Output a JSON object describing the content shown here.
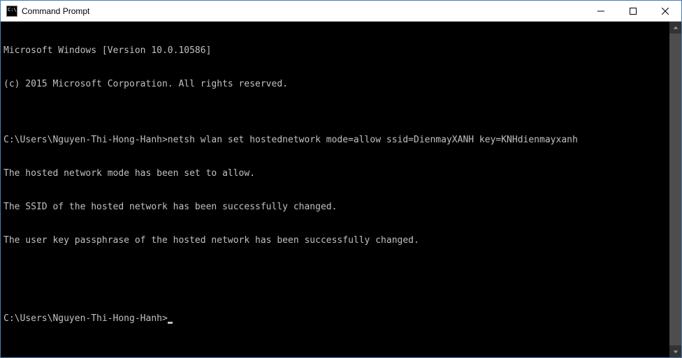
{
  "window": {
    "title": "Command Prompt"
  },
  "terminal": {
    "lines": [
      "Microsoft Windows [Version 10.0.10586]",
      "(c) 2015 Microsoft Corporation. All rights reserved.",
      "",
      "C:\\Users\\Nguyen-Thi-Hong-Hanh>netsh wlan set hostednetwork mode=allow ssid=DienmayXANH key=KNHdienmayxanh",
      "The hosted network mode has been set to allow.",
      "The SSID of the hosted network has been successfully changed.",
      "The user key passphrase of the hosted network has been successfully changed.",
      "",
      "",
      "C:\\Users\\Nguyen-Thi-Hong-Hanh>"
    ]
  }
}
